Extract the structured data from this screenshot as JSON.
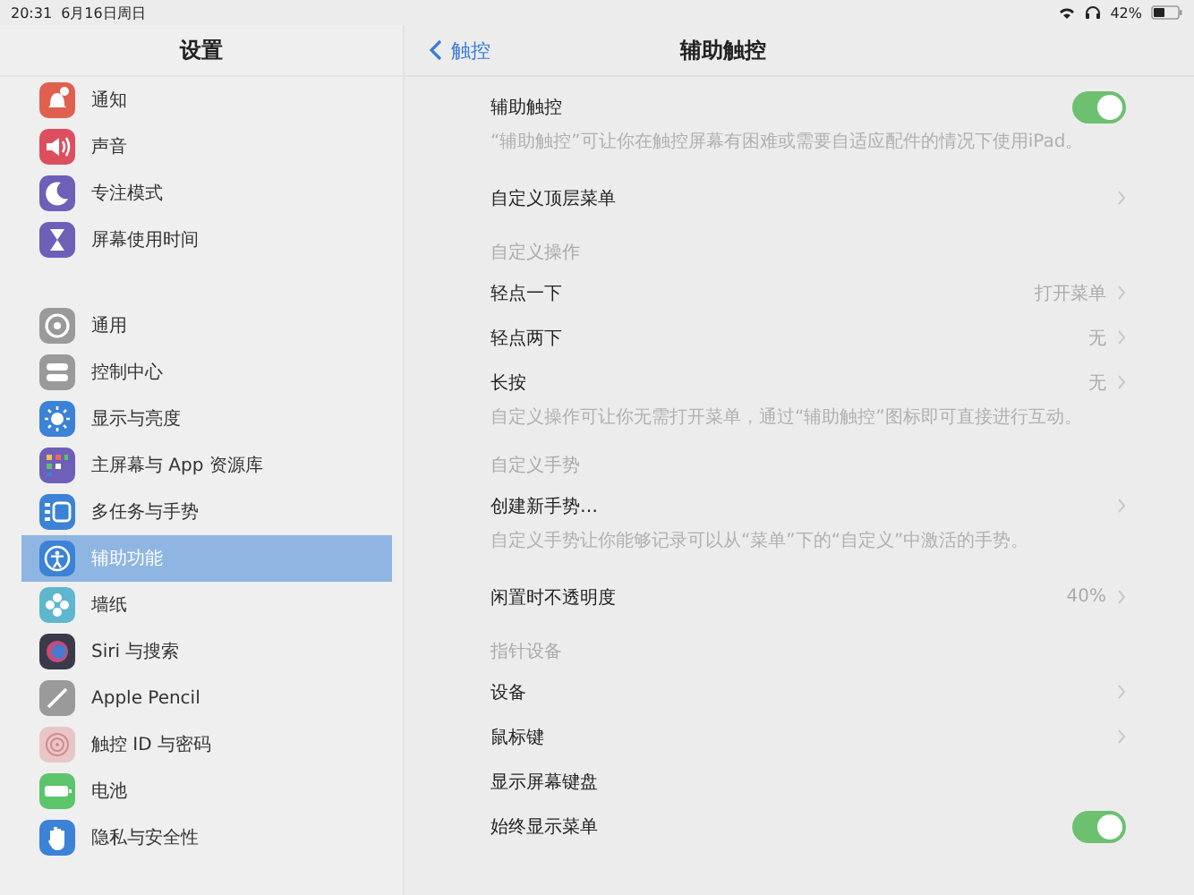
{
  "status_bar": {
    "time": "20:31",
    "date": "6月16日周日",
    "battery": "42%"
  },
  "sidebar": {
    "title": "设置",
    "groups": [
      {
        "items": [
          {
            "label": "通知",
            "color": "#e0604f",
            "selected": false
          },
          {
            "label": "声音",
            "color": "#dd4f5e",
            "selected": false
          },
          {
            "label": "专注模式",
            "color": "#6e5fb8",
            "selected": false
          },
          {
            "label": "屏幕使用时间",
            "color": "#6e5fb8",
            "selected": false
          }
        ]
      },
      {
        "items": [
          {
            "label": "通用",
            "color": "#9a9a9a",
            "selected": false
          },
          {
            "label": "控制中心",
            "color": "#9a9a9a",
            "selected": false
          },
          {
            "label": "显示与亮度",
            "color": "#3c82d6",
            "selected": false
          },
          {
            "label": "主屏幕与 App 资源库",
            "color": "#6e5fb8",
            "selected": false
          },
          {
            "label": "多任务与手势",
            "color": "#3c82d6",
            "selected": false
          },
          {
            "label": "辅助功能",
            "color": "#3c82d6",
            "selected": true
          },
          {
            "label": "墙纸",
            "color": "#5fb6cf",
            "selected": false
          },
          {
            "label": "Siri 与搜索",
            "color": "#3a3a4a",
            "selected": false
          },
          {
            "label": "Apple Pencil",
            "color": "#9a9a9a",
            "selected": false
          },
          {
            "label": "触控 ID 与密码",
            "color": "#e8c6c6",
            "selected": false
          },
          {
            "label": "电池",
            "color": "#5cc46a",
            "selected": false
          },
          {
            "label": "隐私与安全性",
            "color": "#3c82d6",
            "selected": false
          }
        ]
      }
    ]
  },
  "detail": {
    "back": "触控",
    "title": "辅助触控",
    "sections": [
      {
        "rows": [
          {
            "kind": "toggle",
            "label": "辅助触控",
            "on": true
          }
        ],
        "footer": "“辅助触控”可让你在触控屏幕有困难或需要自适应配件的情况下使用iPad。"
      },
      {
        "rows": [
          {
            "kind": "link",
            "label": "自定义顶层菜单"
          }
        ]
      },
      {
        "header": "自定义操作",
        "rows": [
          {
            "kind": "link",
            "label": "轻点一下",
            "value": "打开菜单"
          },
          {
            "kind": "link",
            "label": "轻点两下",
            "value": "无"
          },
          {
            "kind": "link",
            "label": "长按",
            "value": "无"
          }
        ],
        "footer": "自定义操作可让你无需打开菜单，通过“辅助触控”图标即可直接进行互动。"
      },
      {
        "header": "自定义手势",
        "rows": [
          {
            "kind": "link",
            "label": "创建新手势…"
          }
        ],
        "footer": "自定义手势让你能够记录可以从“菜单”下的“自定义”中激活的手势。"
      },
      {
        "rows": [
          {
            "kind": "link",
            "label": "闲置时不透明度",
            "value": "40%"
          }
        ]
      },
      {
        "header": "指针设备",
        "rows": [
          {
            "kind": "link",
            "label": "设备"
          },
          {
            "kind": "link",
            "label": "鼠标键"
          },
          {
            "kind": "plain",
            "label": "显示屏幕键盘"
          },
          {
            "kind": "toggle",
            "label": "始终显示菜单",
            "on": true
          }
        ]
      }
    ]
  }
}
